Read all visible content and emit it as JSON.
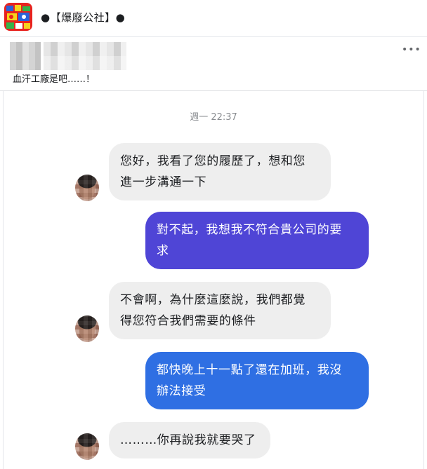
{
  "header": {
    "page_name": "●【爆廢公社】●",
    "icon": "app-logo-icon"
  },
  "post": {
    "caption": "血汗工廠是吧……！",
    "more_icon": "more-options-icon",
    "more_glyph": "•••"
  },
  "chat": {
    "timestamp": "週一 22:37",
    "messages": [
      {
        "from": "other",
        "lines": [
          "您好，我看了您的履歷了，想和您",
          "進一步溝通一下"
        ]
      },
      {
        "from": "me",
        "lines": [
          "對不起，我想我不符合貴公司的要",
          "求"
        ]
      },
      {
        "from": "other",
        "lines": [
          "不會啊，為什麼這麼說，我們都覺",
          "得您符合我們需要的條件"
        ]
      },
      {
        "from": "me",
        "lines": [
          "都快晚上十一點了還在加班，我沒",
          "辦法接受"
        ]
      },
      {
        "from": "other",
        "lines": [
          "………你再說我就要哭了"
        ]
      }
    ]
  },
  "colors": {
    "bubble_in": "#eeeeee",
    "bubble_out_purple": "#4f45d6",
    "bubble_out_blue": "#2f6fe3"
  }
}
